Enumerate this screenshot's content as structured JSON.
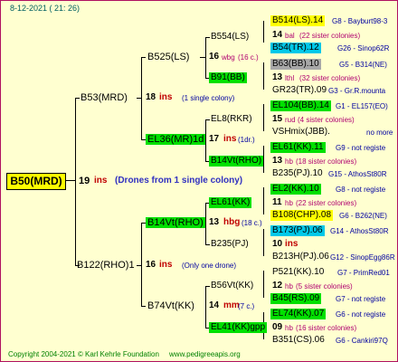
{
  "header": {
    "date": "8-12-2021 ( 21: 26)"
  },
  "footer": {
    "copyright": "Copyright 2004-2021 © Karl Kehrle Foundation",
    "website": "www.pedigreeapis.org"
  },
  "root": {
    "label": "B50(MRD)",
    "ins_count": "19",
    "ins_word": "ins",
    "note": "(Drones from 1 single colony)"
  },
  "g1": {
    "top": {
      "label": "B53(MRD)",
      "ins_count": "18",
      "ins_word": "ins",
      "note": "(1 single colony)"
    },
    "bot": {
      "label": "B122(RHO)1",
      "ins_count": "16",
      "ins_word": "ins",
      "note": "(Only one drone)"
    }
  },
  "g2": {
    "a": {
      "label": "B525(LS)"
    },
    "b": {
      "label": "EL36(MR)1d",
      "ins_count": "17",
      "ins_word": "ins",
      "note": "(1dr.)"
    },
    "c": {
      "label": "B14Vt(RHO)",
      "ins_count": "13",
      "ins_word": "hbg",
      "note": "(18 c.)"
    },
    "d": {
      "label": "B74Vt(KK)",
      "ins_count": "14",
      "ins_word": "mm",
      "note": "(7 c.)"
    }
  },
  "g3": {
    "a1": {
      "label": "B554(LS)",
      "ins_count": "16",
      "ins_word": "wbg",
      "note": "(16 c.)"
    },
    "a2": {
      "label": "B91(BB)"
    },
    "b1": {
      "label": "EL8(RKR)"
    },
    "b2": {
      "label": "B14Vt(RHO)"
    },
    "c1": {
      "label": "EL61(KK)"
    },
    "c2": {
      "label": "B235(PJ)",
      "ins_count": "10",
      "ins_word": "ins"
    },
    "d1": {
      "label": "B56Vt(KK)"
    },
    "d2": {
      "label": "EL41(KK)gpp"
    }
  },
  "g4": [
    {
      "label": "B514(LS).14",
      "ref": "G8 - Bayburt98-3"
    },
    {
      "count": "14",
      "word": "bal",
      "note": "(22 sister colonies)"
    },
    {
      "label": "B54(TR).12",
      "ref": "G26 - Sinop62R"
    },
    {
      "label": "B63(BB).10",
      "ref": "G5 - B314(NE)"
    },
    {
      "count": "13",
      "word": "lthl",
      "note": "(32 sister colonies)"
    },
    {
      "label": "GR23(TR).09",
      "ref": "G3 - Gr.R.mounta"
    },
    {
      "label": "EL104(BB).14",
      "ref": "G1 - EL157(EO)"
    },
    {
      "count": "15",
      "word": "rud",
      "note": "(4 sister colonies)"
    },
    {
      "label": "VSHmix(JBB).",
      "ref": "no more"
    },
    {
      "label": "EL61(KK).11",
      "ref": "G9 - not registe"
    },
    {
      "count": "13",
      "word": "hb",
      "note": "(18 sister colonies)"
    },
    {
      "label": "B235(PJ).10",
      "ref": "G15 - AthosSt80R"
    },
    {
      "label": "EL2(KK).10",
      "ref": "G8 - not registe"
    },
    {
      "count": "11",
      "word": "hb",
      "note": "(22 sister colonies)"
    },
    {
      "label": "B108(CHP).08",
      "ref": "G6 - B262(NE)"
    },
    {
      "label": "B173(PJ).06",
      "ref": "G14 - AthosSt80R"
    },
    {
      "label": "B213H(PJ).06",
      "ref": "G12 - SinopEgg86R"
    },
    {
      "label": "P521(KK).10",
      "ref": "G7 - PrimRed01"
    },
    {
      "count": "12",
      "word": "hb",
      "note": "(5 sister colonies)"
    },
    {
      "label": "B45(RS).09",
      "ref": "G7 - not registe"
    },
    {
      "label": "EL74(KK).07",
      "ref": "G6 - not registe"
    },
    {
      "count": "09",
      "word": "hb",
      "note": "(16 sister colonies)"
    },
    {
      "label": "B351(CS).06",
      "ref": "G6 - Cankiri97Q"
    }
  ]
}
